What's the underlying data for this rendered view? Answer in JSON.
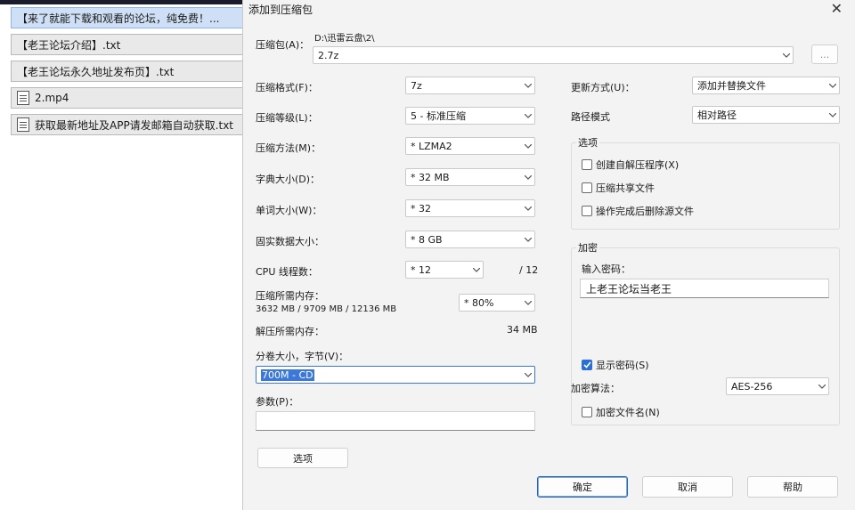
{
  "desktop": {
    "files": [
      {
        "name": "【来了就能下载和观看的论坛，纯免费！...",
        "selected": true
      },
      {
        "name": "【老王论坛介绍】.txt"
      },
      {
        "name": "【老王论坛永久地址发布页】.txt"
      },
      {
        "name": "2.mp4"
      },
      {
        "name": "获取最新地址及APP请发邮箱自动获取.txt"
      }
    ]
  },
  "dialog": {
    "title": "添加到压缩包",
    "close_glyph": "✕",
    "archive": {
      "label": "压缩包(A)：",
      "path": "D:\\迅雷云盘\\2\\",
      "name": "2.7z",
      "browse_label": "..."
    },
    "format": {
      "label": "压缩格式(F)：",
      "value": "7z"
    },
    "level": {
      "label": "压缩等级(L)：",
      "value": "5 - 标准压缩"
    },
    "method": {
      "label": "压缩方法(M)：",
      "value": "* LZMA2"
    },
    "dict_size": {
      "label": "字典大小(D)：",
      "value": "* 32 MB"
    },
    "word_size": {
      "label": "单词大小(W)：",
      "value": "* 32"
    },
    "solid_size": {
      "label": "固实数据大小：",
      "value": "* 8 GB"
    },
    "cpu_threads": {
      "label": "CPU 线程数：",
      "value": "* 12",
      "max": "/ 12"
    },
    "memory_compress": {
      "label": "压缩所需内存：",
      "detail": "3632 MB / 9709 MB / 12136 MB",
      "value": "* 80%"
    },
    "memory_decompress": {
      "label": "解压所需内存：",
      "value": "34 MB"
    },
    "volume": {
      "label": "分卷大小，字节(V)：",
      "value": "700M - CD"
    },
    "params": {
      "label": "参数(P)：",
      "value": ""
    },
    "options_button": "选项",
    "update_mode": {
      "label": "更新方式(U)：",
      "value": "添加并替换文件"
    },
    "path_mode": {
      "label": "路径模式",
      "value": "相对路径"
    },
    "options_group": {
      "title": "选项",
      "items": [
        {
          "label": "创建自解压程序(X)",
          "checked": false
        },
        {
          "label": "压缩共享文件",
          "checked": false
        },
        {
          "label": "操作完成后删除源文件",
          "checked": false
        }
      ]
    },
    "encryption": {
      "title": "加密",
      "password_label": "输入密码：",
      "password_value": "上老王论坛当老王",
      "show_password": {
        "label": "显示密码(S)",
        "checked": true
      },
      "algo_label": "加密算法：",
      "algo_value": "AES-256",
      "encrypt_names": {
        "label": "加密文件名(N)",
        "checked": false
      }
    },
    "buttons": {
      "ok": "确定",
      "cancel": "取消",
      "help": "帮助"
    }
  },
  "colors": {
    "accent": "#2a6fd6",
    "dialog_bg": "#f3f3f3",
    "selection": "#3c78d8"
  }
}
